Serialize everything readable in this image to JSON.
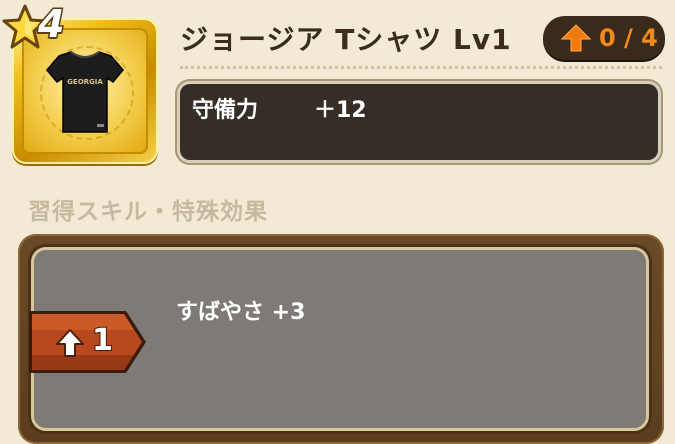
{
  "item": {
    "title": "ジョージア Tシャツ Lv1",
    "rarity_stars": "4",
    "shirt_print": "GEORGIA",
    "icon": "tshirt-icon"
  },
  "upgrade": {
    "count": "0 / 4",
    "icon": "up-arrow-icon"
  },
  "stats": [
    {
      "label": "守備力",
      "value": "＋12"
    }
  ],
  "skills_section": {
    "heading": "習得スキル・特殊効果",
    "entries": [
      {
        "level": "1",
        "text": "すばやさ +3"
      }
    ]
  },
  "colors": {
    "background": "#f3ead6",
    "stat_panel": "#362d27",
    "skill_panel": "#7e7a75",
    "skill_frame": "#5b3d1e",
    "upgrade_accent": "#f08a18",
    "level_tag": "#b8491f",
    "gold": "#f2c21a"
  }
}
